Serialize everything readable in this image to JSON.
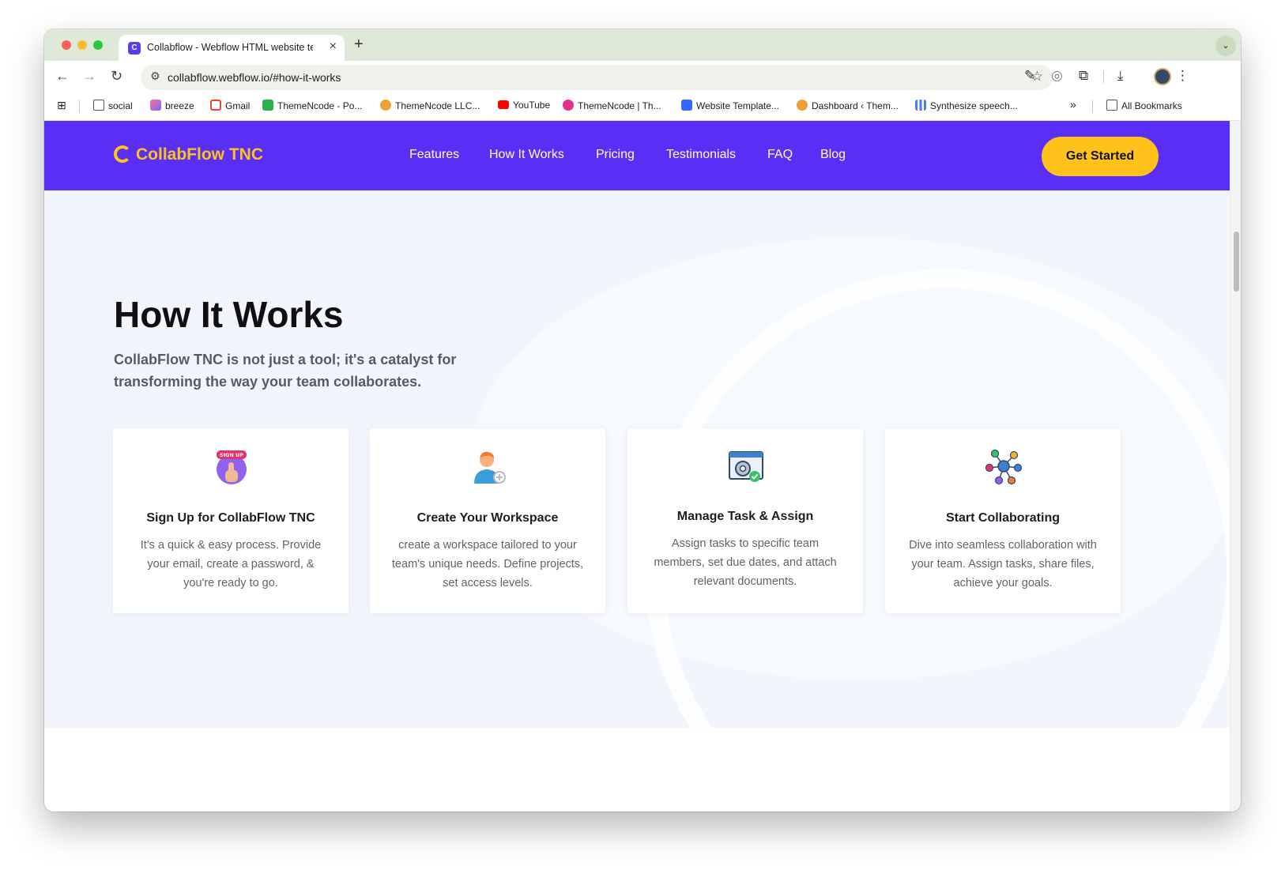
{
  "browser": {
    "tab_title": "Collabflow - Webflow HTML website template",
    "tab_favicon_letter": "C",
    "url": "collabflow.webflow.io/#how-it-works",
    "bookmarks": [
      {
        "label": "social",
        "icon": "folder-icon"
      },
      {
        "label": "breeze",
        "icon": "breeze-icon"
      },
      {
        "label": "Gmail",
        "icon": "gmail-icon"
      },
      {
        "label": "ThemeNcode - Po...",
        "icon": "themencode-icon"
      },
      {
        "label": "ThemeNcode LLC...",
        "icon": "themencode-llc-icon"
      },
      {
        "label": "YouTube",
        "icon": "youtube-icon"
      },
      {
        "label": "ThemeNcode | Th...",
        "icon": "themencode-th-icon"
      },
      {
        "label": "Website Template...",
        "icon": "webflow-icon"
      },
      {
        "label": "Dashboard ‹ Them...",
        "icon": "dashboard-icon"
      },
      {
        "label": "Synthesize speech...",
        "icon": "speech-icon"
      }
    ],
    "all_bookmarks_label": "All Bookmarks"
  },
  "site": {
    "brand": "CollabFlow TNC",
    "nav": [
      "Features",
      "How It Works",
      "Pricing",
      "Testimonials",
      "FAQ",
      "Blog"
    ],
    "cta": "Get Started",
    "brand_color": "#5a2ff5",
    "accent_color": "#ffc21a"
  },
  "section": {
    "title": "How It Works",
    "subtitle": "CollabFlow TNC is not just a tool; it's a catalyst for transforming the way your team collaborates.",
    "cards": [
      {
        "icon": "signup-icon",
        "badge": "SIGN UP",
        "title": "Sign Up for CollabFlow TNC",
        "text": "It's a quick & easy process. Provide your email, create a password, & you're ready to go."
      },
      {
        "icon": "add-user-icon",
        "title": "Create Your Workspace",
        "text": "create a workspace tailored to your team's unique needs. Define projects, set access levels."
      },
      {
        "icon": "task-settings-icon",
        "title": "Manage Task & Assign",
        "text": "Assign tasks to specific team members, set due dates, and attach relevant documents."
      },
      {
        "icon": "team-network-icon",
        "title": "Start Collaborating",
        "text": "Dive into seamless collaboration with your team. Assign tasks, share files, achieve your goals."
      }
    ]
  }
}
